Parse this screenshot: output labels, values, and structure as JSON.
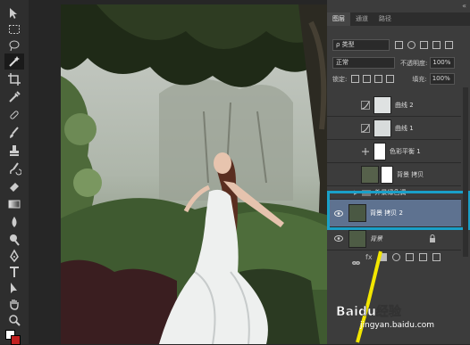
{
  "panel": {
    "tabs": [
      "图层",
      "通道",
      "路径"
    ],
    "filter_kind": "ρ 类型",
    "blend_mode": "正常",
    "opacity_label": "不透明度:",
    "opacity_value": "100%",
    "lock_label": "锁定:",
    "fill_label": "填充:",
    "fill_value": "100%"
  },
  "layers": [
    {
      "name": "曲线 2"
    },
    {
      "name": "曲线 1"
    },
    {
      "name": "色彩平衡 1"
    },
    {
      "name": "背景 拷贝"
    },
    {
      "name": "外景绿色调"
    },
    {
      "name": "背景 拷贝 2"
    },
    {
      "name": "背景"
    }
  ],
  "watermark": {
    "brand": "Baidu经验",
    "url": "jingyan.baidu.com"
  },
  "colors": {
    "highlight": "#1aa0c8",
    "arrow": "#f2e600",
    "selected": "#5e7290"
  }
}
